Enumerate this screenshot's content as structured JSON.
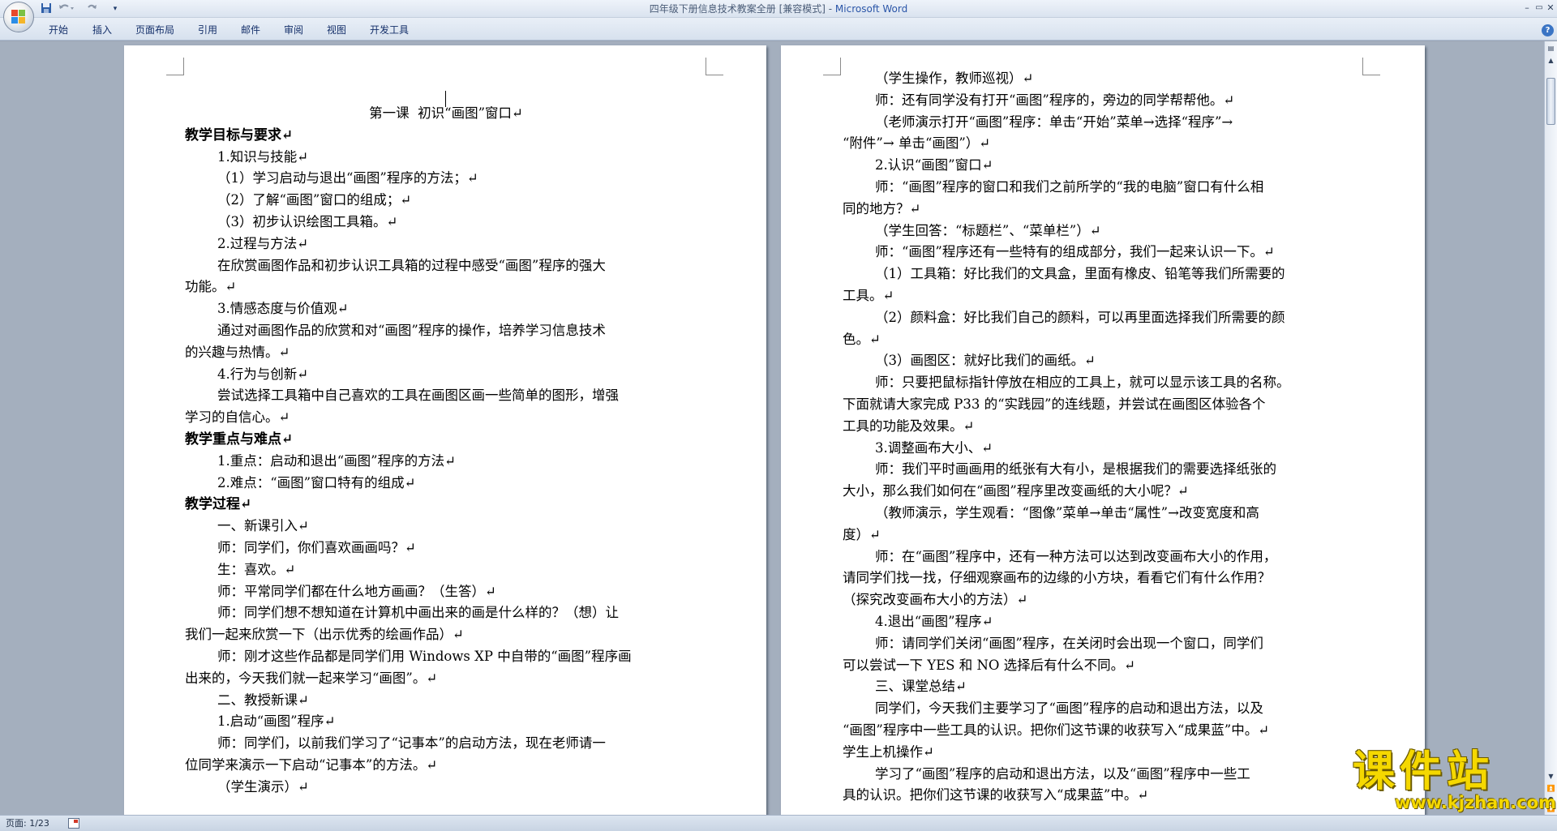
{
  "window": {
    "title": "四年级下册信息技术教案全册 [兼容模式] - ",
    "app_name": "Microsoft Word",
    "controls": {
      "minimize": "–",
      "maximize": "▭",
      "close": "✕"
    }
  },
  "quick_access": {
    "save_icon": "save-icon",
    "undo_icon": "undo-icon",
    "redo_icon": "redo-icon",
    "customize_icon": "dropdown-icon"
  },
  "ribbon": {
    "tabs": [
      "开始",
      "插入",
      "页面布局",
      "引用",
      "邮件",
      "审阅",
      "视图",
      "开发工具"
    ],
    "help": "?"
  },
  "pages": [
    {
      "lines": [
        {
          "text": "第一课  初识“画图”窗口↵",
          "style": "center"
        },
        {
          "text": "教学目标与要求↵",
          "style": "bold"
        },
        {
          "text": "1.知识与技能↵",
          "style": "indent"
        },
        {
          "text": "（1）学习启动与退出“画图”程序的方法；↵",
          "style": "indent"
        },
        {
          "text": "（2）了解“画图”窗口的组成；↵",
          "style": "indent"
        },
        {
          "text": "（3）初步认识绘图工具箱。↵",
          "style": "indent"
        },
        {
          "text": "2.过程与方法↵",
          "style": "indent"
        },
        {
          "text": "在欣赏画图作品和初步认识工具箱的过程中感受“画图”程序的强大",
          "style": "indent"
        },
        {
          "text": "功能。↵",
          "style": "plain"
        },
        {
          "text": "3.情感态度与价值观↵",
          "style": "indent"
        },
        {
          "text": "通过对画图作品的欣赏和对“画图”程序的操作，培养学习信息技术",
          "style": "indent"
        },
        {
          "text": "的兴趣与热情。↵",
          "style": "plain"
        },
        {
          "text": "4.行为与创新↵",
          "style": "indent"
        },
        {
          "text": "尝试选择工具箱中自己喜欢的工具在画图区画一些简单的图形，增强",
          "style": "indent"
        },
        {
          "text": "学习的自信心。↵",
          "style": "plain"
        },
        {
          "text": "教学重点与难点↵",
          "style": "bold"
        },
        {
          "text": "1.重点：启动和退出“画图”程序的方法↵",
          "style": "indent"
        },
        {
          "text": "2.难点：“画图”窗口特有的组成↵",
          "style": "indent"
        },
        {
          "text": "教学过程↵",
          "style": "bold"
        },
        {
          "text": "一、新课引入↵",
          "style": "indent"
        },
        {
          "text": "师：同学们，你们喜欢画画吗？↵",
          "style": "indent"
        },
        {
          "text": "生：喜欢。↵",
          "style": "indent"
        },
        {
          "text": "师：平常同学们都在什么地方画画？（生答）↵",
          "style": "indent"
        },
        {
          "text": "师：同学们想不想知道在计算机中画出来的画是什么样的？（想）让",
          "style": "indent"
        },
        {
          "text": "我们一起来欣赏一下（出示优秀的绘画作品）↵",
          "style": "plain"
        },
        {
          "text": "师：刚才这些作品都是同学们用 Windows XP 中自带的“画图”程序画",
          "style": "indent"
        },
        {
          "text": "出来的，今天我们就一起来学习“画图”。↵",
          "style": "plain"
        },
        {
          "text": "二、教授新课↵",
          "style": "indent"
        },
        {
          "text": "1.启动“画图”程序↵",
          "style": "indent"
        },
        {
          "text": "师：同学们，以前我们学习了“记事本”的启动方法，现在老师请一",
          "style": "indent"
        },
        {
          "text": "位同学来演示一下启动“记事本”的方法。↵",
          "style": "plain"
        },
        {
          "text": "（学生演示）↵",
          "style": "indent"
        }
      ]
    },
    {
      "lines": [
        {
          "text": "（学生操作，教师巡视）↵",
          "style": "indent"
        },
        {
          "text": "师：还有同学没有打开“画图”程序的，旁边的同学帮帮他。↵",
          "style": "indent"
        },
        {
          "text": "（老师演示打开“画图”程序：单击“开始”菜单→选择“程序”→",
          "style": "indent"
        },
        {
          "text": "“附件”→ 单击“画图”）↵",
          "style": "plain"
        },
        {
          "text": "2.认识“画图”窗口↵",
          "style": "indent"
        },
        {
          "text": "师：“画图”程序的窗口和我们之前所学的“我的电脑”窗口有什么相",
          "style": "indent"
        },
        {
          "text": "同的地方？↵",
          "style": "plain"
        },
        {
          "text": "（学生回答：“标题栏”、“菜单栏”）↵",
          "style": "indent"
        },
        {
          "text": "师：“画图”程序还有一些特有的组成部分，我们一起来认识一下。↵",
          "style": "indent"
        },
        {
          "text": "（1）工具箱：好比我们的文具盒，里面有橡皮、铅笔等我们所需要的",
          "style": "indent"
        },
        {
          "text": "工具。↵",
          "style": "plain"
        },
        {
          "text": "（2）颜料盒：好比我们自己的颜料，可以再里面选择我们所需要的颜",
          "style": "indent"
        },
        {
          "text": "色。↵",
          "style": "plain"
        },
        {
          "text": "（3）画图区：就好比我们的画纸。↵",
          "style": "indent"
        },
        {
          "text": "师：只要把鼠标指针停放在相应的工具上，就可以显示该工具的名称。",
          "style": "indent"
        },
        {
          "text": "下面就请大家完成 P33 的“实践园”的连线题，并尝试在画图区体验各个",
          "style": "plain"
        },
        {
          "text": "工具的功能及效果。↵",
          "style": "plain"
        },
        {
          "text": "3.调整画布大小、↵",
          "style": "indent"
        },
        {
          "text": "师：我们平时画画用的纸张有大有小，是根据我们的需要选择纸张的",
          "style": "indent"
        },
        {
          "text": "大小，那么我们如何在“画图”程序里改变画纸的大小呢？↵",
          "style": "plain"
        },
        {
          "text": "（教师演示，学生观看：“图像”菜单→单击“属性”→改变宽度和高",
          "style": "indent"
        },
        {
          "text": "度）↵",
          "style": "plain"
        },
        {
          "text": "师：在“画图”程序中，还有一种方法可以达到改变画布大小的作用，",
          "style": "indent"
        },
        {
          "text": "请同学们找一找，仔细观察画布的边缘的小方块，看看它们有什么作用？",
          "style": "plain"
        },
        {
          "text": "（探究改变画布大小的方法）↵",
          "style": "plain"
        },
        {
          "text": "4.退出“画图”程序↵",
          "style": "indent"
        },
        {
          "text": "师：请同学们关闭“画图”程序，在关闭时会出现一个窗口，同学们",
          "style": "indent"
        },
        {
          "text": "可以尝试一下 YES 和 NO 选择后有什么不同。↵",
          "style": "plain"
        },
        {
          "text": "三、课堂总结↵",
          "style": "indent"
        },
        {
          "text": "同学们，今天我们主要学习了“画图”程序的启动和退出方法，以及",
          "style": "indent"
        },
        {
          "text": "“画图”程序中一些工具的认识。把你们这节课的收获写入“成果蓝”中。↵",
          "style": "plain"
        },
        {
          "text": "学生上机操作↵",
          "style": "plain"
        },
        {
          "text": "学习了“画图”程序的启动和退出方法，以及“画图”程序中一些工",
          "style": "indent"
        },
        {
          "text": "具的认识。把你们这节课的收获写入“成果蓝”中。↵",
          "style": "plain"
        }
      ]
    }
  ],
  "statusbar": {
    "page": "页面: 1/23"
  },
  "watermark": {
    "main": "课件站",
    "url": "www.kjzhan.com"
  }
}
